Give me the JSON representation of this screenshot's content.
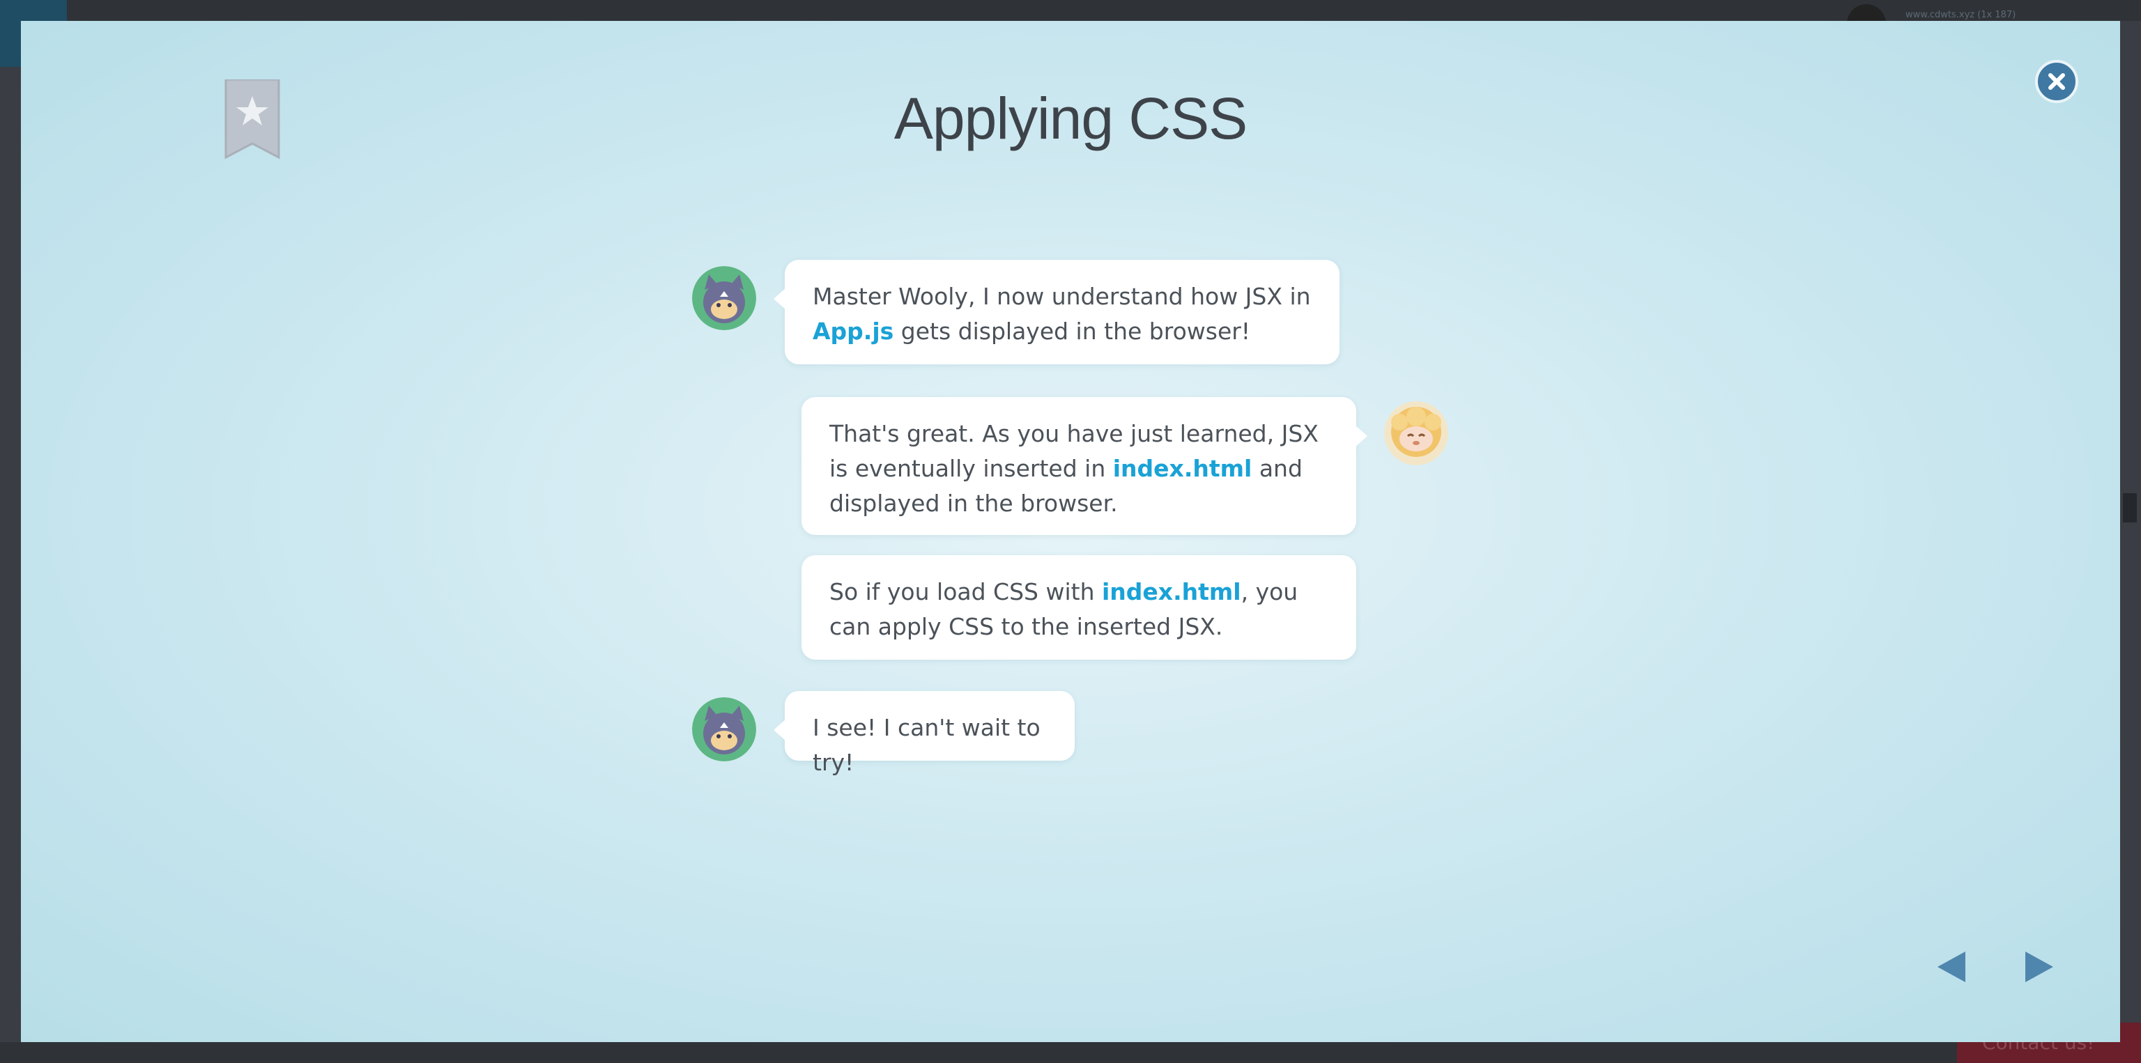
{
  "background": {
    "user_text": "www.cdwts.xyz (1x 187)",
    "contact_label": "Contact us!"
  },
  "modal": {
    "title": "Applying CSS",
    "colors": {
      "accent": "#1aa2d6",
      "close_bg": "#3f78a2",
      "nav_arrow": "#4f86ae",
      "bookmark": "#bcc3cc"
    },
    "icons": {
      "bookmark": "bookmark-star-icon",
      "close": "close-icon",
      "prev": "triangle-left-icon",
      "next": "triangle-right-icon"
    },
    "messages": [
      {
        "speaker": "student",
        "parts": [
          {
            "text": "Master Wooly, I now understand how JSX in ",
            "highlight": false
          },
          {
            "text": "App.js",
            "highlight": true
          },
          {
            "text": " gets displayed in the browser!",
            "highlight": false
          }
        ]
      },
      {
        "speaker": "wooly",
        "parts": [
          {
            "text": "That's great. As you have just learned, JSX is eventually inserted in ",
            "highlight": false
          },
          {
            "text": "index.html",
            "highlight": true
          },
          {
            "text": " and displayed in the browser.",
            "highlight": false
          }
        ]
      },
      {
        "speaker": "wooly",
        "parts": [
          {
            "text": "So if you load CSS with ",
            "highlight": false
          },
          {
            "text": "index.html",
            "highlight": true
          },
          {
            "text": ", you can apply CSS to the inserted JSX.",
            "highlight": false
          }
        ]
      },
      {
        "speaker": "student",
        "parts": [
          {
            "text": "I see! I can't wait to try!",
            "highlight": false
          }
        ]
      }
    ]
  }
}
